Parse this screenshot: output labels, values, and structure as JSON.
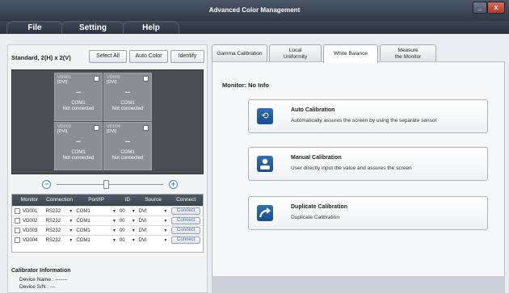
{
  "window": {
    "title": "Advanced Color Management",
    "minimize": "_",
    "close": "x"
  },
  "menu": {
    "items": [
      "File",
      "Setting",
      "Help"
    ]
  },
  "left": {
    "layout_label": "Standard, 2(H) x 2(V)",
    "buttons": {
      "select_all": "Select All",
      "auto_color": "Auto Color",
      "identify": "Identify"
    },
    "tiles": [
      {
        "name": "VD001",
        "source": "[DVI]",
        "value": "--",
        "port": "COM1",
        "status": "Not connected"
      },
      {
        "name": "VD002",
        "source": "[DVI]",
        "value": "--",
        "port": "COM1",
        "status": "Not connected"
      },
      {
        "name": "VD003",
        "source": "[DVI]",
        "value": "--",
        "port": "COM1",
        "status": "Not connected"
      },
      {
        "name": "VD004",
        "source": "[DVI]",
        "value": "--",
        "port": "COM1",
        "status": "Not connected"
      }
    ],
    "zoom": {
      "minus": "−",
      "plus": "+"
    },
    "table": {
      "headers": [
        "Monitor",
        "Connection",
        "Port/IP",
        "ID",
        "Source",
        "Connect"
      ],
      "rows": [
        {
          "monitor": "VD001",
          "connection": "RS232",
          "port": "COM1",
          "id": "00",
          "source": "DVI",
          "action": "Connect"
        },
        {
          "monitor": "VD002",
          "connection": "RS232",
          "port": "COM1",
          "id": "00",
          "source": "DVI",
          "action": "Connect"
        },
        {
          "monitor": "VD003",
          "connection": "RS232",
          "port": "COM1",
          "id": "00",
          "source": "DVI",
          "action": "Connect"
        },
        {
          "monitor": "VD004",
          "connection": "RS232",
          "port": "COM1",
          "id": "00",
          "source": "DVI",
          "action": "Connect"
        }
      ]
    },
    "calibrator": {
      "title": "Calibrator Information",
      "device_name": "Device Name : -------",
      "device_sn": "Device S/N    : ---"
    }
  },
  "right": {
    "tabs": [
      {
        "label": "Gamma Calibration"
      },
      {
        "label": "Local\nUniformity"
      },
      {
        "label": "White Balance"
      },
      {
        "label": "Measure\nthe Monitor"
      }
    ],
    "monitor_info": "Monitor: No Info",
    "cards": [
      {
        "title": "Auto Calibration",
        "desc": "Automatically assures the screen by using the separate sensor",
        "icon": "refresh-icon"
      },
      {
        "title": "Manual Calibration",
        "desc": "User directly input the value and assures the screen",
        "icon": "user-icon"
      },
      {
        "title": "Duplicate Calibration",
        "desc": "Duplicate Calibration",
        "icon": "curved-arrow-icon"
      }
    ]
  },
  "colors": {
    "accent": "#1f5fa3",
    "titlebar": "#2f3a46",
    "tile": "#8a8f95"
  }
}
